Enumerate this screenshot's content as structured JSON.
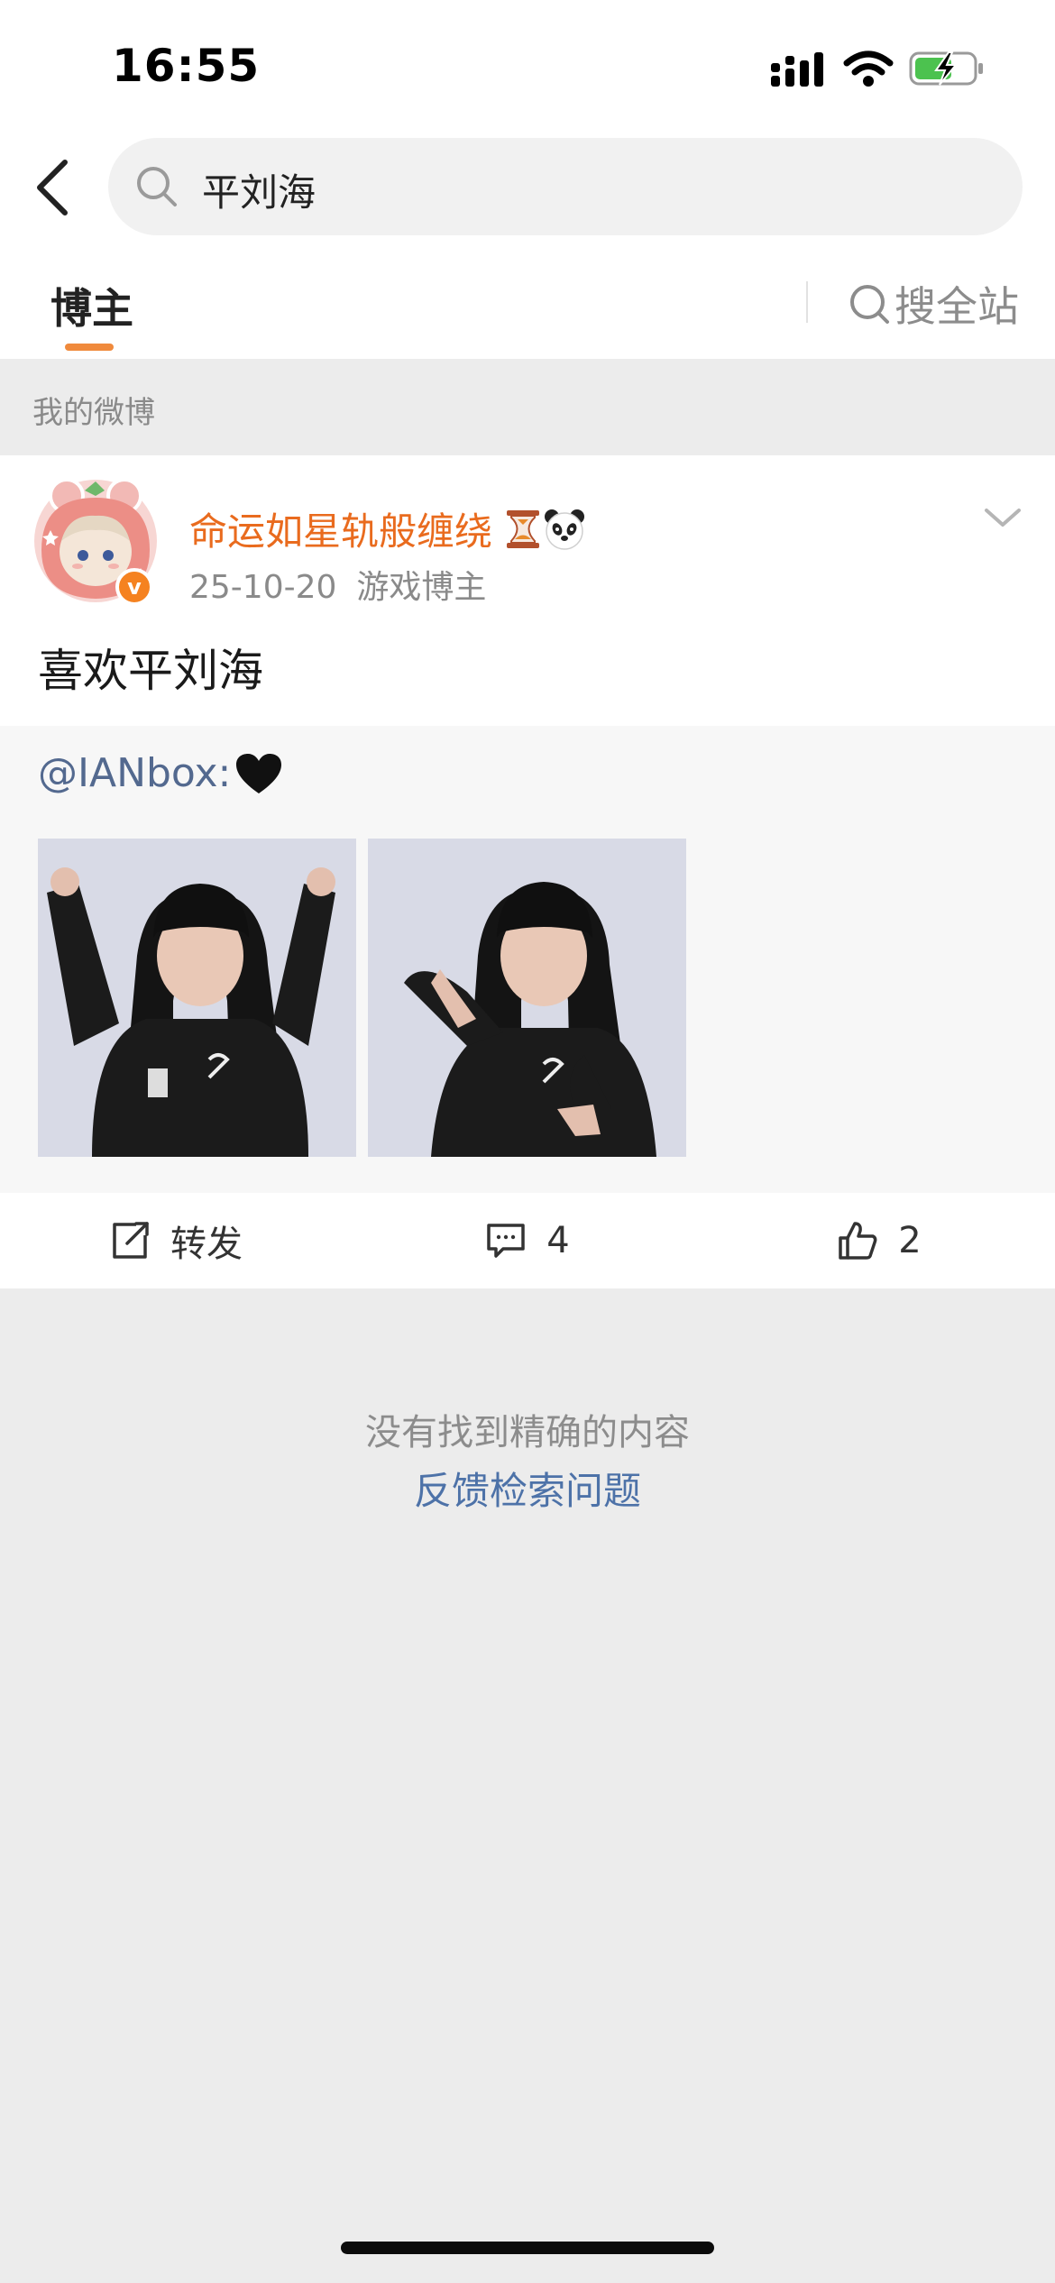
{
  "status_bar": {
    "time": "16:55"
  },
  "search": {
    "query": "平刘海"
  },
  "tabs": {
    "active": "博主",
    "search_all": "搜全站"
  },
  "section": {
    "title": "我的微博"
  },
  "post": {
    "username": "命运如星轨般缠绕",
    "date": "25-10-20",
    "tag": "游戏博主",
    "text": "喜欢平刘海",
    "verified_badge": "v",
    "repost": {
      "author": "@IANbox:"
    },
    "actions": {
      "repost_label": "转发",
      "comment_count": "4",
      "like_count": "2"
    }
  },
  "empty_state": {
    "message": "没有找到精确的内容",
    "feedback_link": "反馈检索问题"
  },
  "colors": {
    "accent_orange": "#f08a3c",
    "username_orange": "#e96b1e",
    "link_blue": "#4d72a8",
    "background": "#ececec"
  }
}
